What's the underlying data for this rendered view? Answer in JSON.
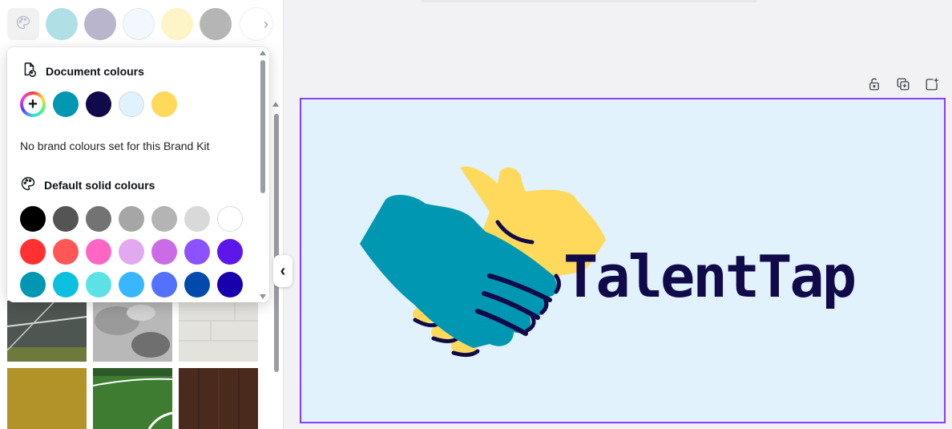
{
  "quick_colours": {
    "swatches": [
      "#b0e0e6",
      "#b8b5cc",
      "#f2f8fd",
      "#fdf4c8",
      "#b5b5b5"
    ]
  },
  "colour_popup": {
    "document_section": {
      "title": "Document colours",
      "icon": "document-colours-icon",
      "add_button_icon": "plus-icon",
      "swatches": [
        "#0097b2",
        "#10094a",
        "#e1f2fd",
        "#ffd95b"
      ]
    },
    "brand_message": "No brand colours set for this Brand Kit",
    "default_section": {
      "title": "Default solid colours",
      "icon": "palette-icon",
      "rows": [
        [
          "#000000",
          "#545454",
          "#737373",
          "#a6a6a6",
          "#b4b4b4",
          "#d9d9d9",
          "#ffffff"
        ],
        [
          "#ff3131",
          "#ff5757",
          "#ff66c4",
          "#e2a9f1",
          "#cb6ce6",
          "#8c52ff",
          "#5e17eb"
        ],
        [
          "#0097b2",
          "#0cc0df",
          "#5ce1e6",
          "#38b6ff",
          "#5271ff",
          "#004aad",
          "#1800ad"
        ]
      ]
    }
  },
  "textures": [
    {
      "name": "asphalt-road-texture",
      "color": "#4b5350"
    },
    {
      "name": "grey-watercolour-texture",
      "color": "#a9a9a9"
    },
    {
      "name": "white-wood-planks-texture",
      "color": "#e3e1dc"
    },
    {
      "name": "gold-glitter-texture",
      "color": "#b89a2a"
    },
    {
      "name": "football-field-texture",
      "color": "#3f7f33"
    },
    {
      "name": "dark-wood-texture",
      "color": "#4a2a1d"
    }
  ],
  "canvas": {
    "background": "#e1f2fd",
    "selection_color": "#8b3dff",
    "brand_name": "TalentTap",
    "tools": [
      "lock-icon",
      "duplicate-icon",
      "add-page-icon"
    ]
  }
}
